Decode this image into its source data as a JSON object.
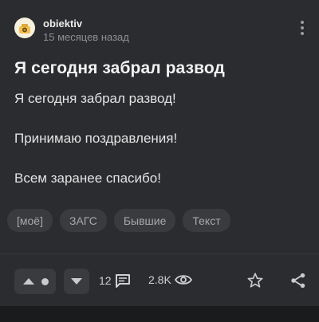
{
  "post": {
    "author": "obiektiv",
    "time": "15 месяцев назад",
    "title": "Я сегодня забрал развод",
    "body": [
      "Я сегодня забрал развод!",
      "Принимаю поздравления!",
      "Всем заранее спасибо!"
    ],
    "tags": [
      "[моё]",
      "ЗАГС",
      "Бывшие",
      "Текст"
    ]
  },
  "footer": {
    "comments_count": "12",
    "views_count": "2.8K"
  },
  "icons": {
    "more": "more-vertical-icon",
    "upvote": "arrow-up-icon",
    "downvote": "arrow-down-icon",
    "comments": "comment-icon",
    "views": "eye-icon",
    "save": "star-icon",
    "share": "share-icon"
  },
  "colors": {
    "background": "#2b2c2f",
    "chip": "#3a3b3f",
    "muted_text": "#8e8f93"
  }
}
